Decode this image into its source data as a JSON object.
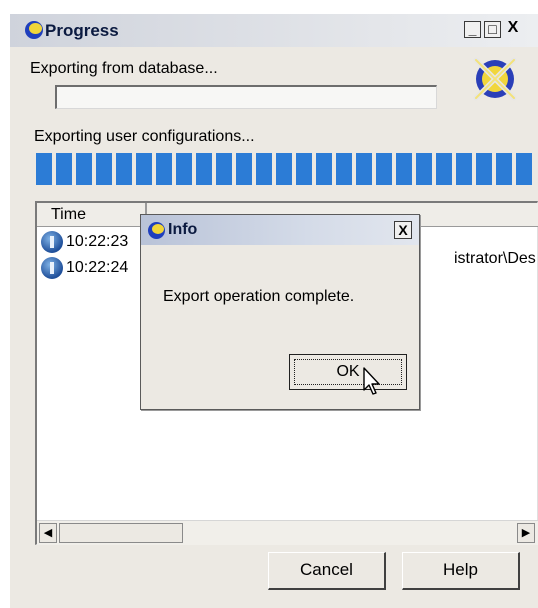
{
  "window": {
    "title": "Progress",
    "controls": {
      "minimize": "_",
      "maximize": "□",
      "close": "X"
    }
  },
  "database": {
    "label": "Exporting from database...",
    "progress": 0
  },
  "configurations": {
    "label": "Exporting user configurations...",
    "progress": 1.0
  },
  "log": {
    "columns": [
      "Time",
      ""
    ],
    "rows": [
      {
        "time": "10:22:23",
        "icon": "info-icon"
      },
      {
        "time": "10:22:24",
        "icon": "info-icon"
      }
    ],
    "message_fragment": "istrator\\Des"
  },
  "buttons": {
    "cancel": "Cancel",
    "help": "Help"
  },
  "dialog": {
    "title": "Info",
    "close": "X",
    "message": "Export operation complete.",
    "ok": "OK"
  },
  "colors": {
    "progress_fill": "#2c7cd6",
    "title_text": "#0b1a40",
    "window_bg": "#ece9e3"
  }
}
